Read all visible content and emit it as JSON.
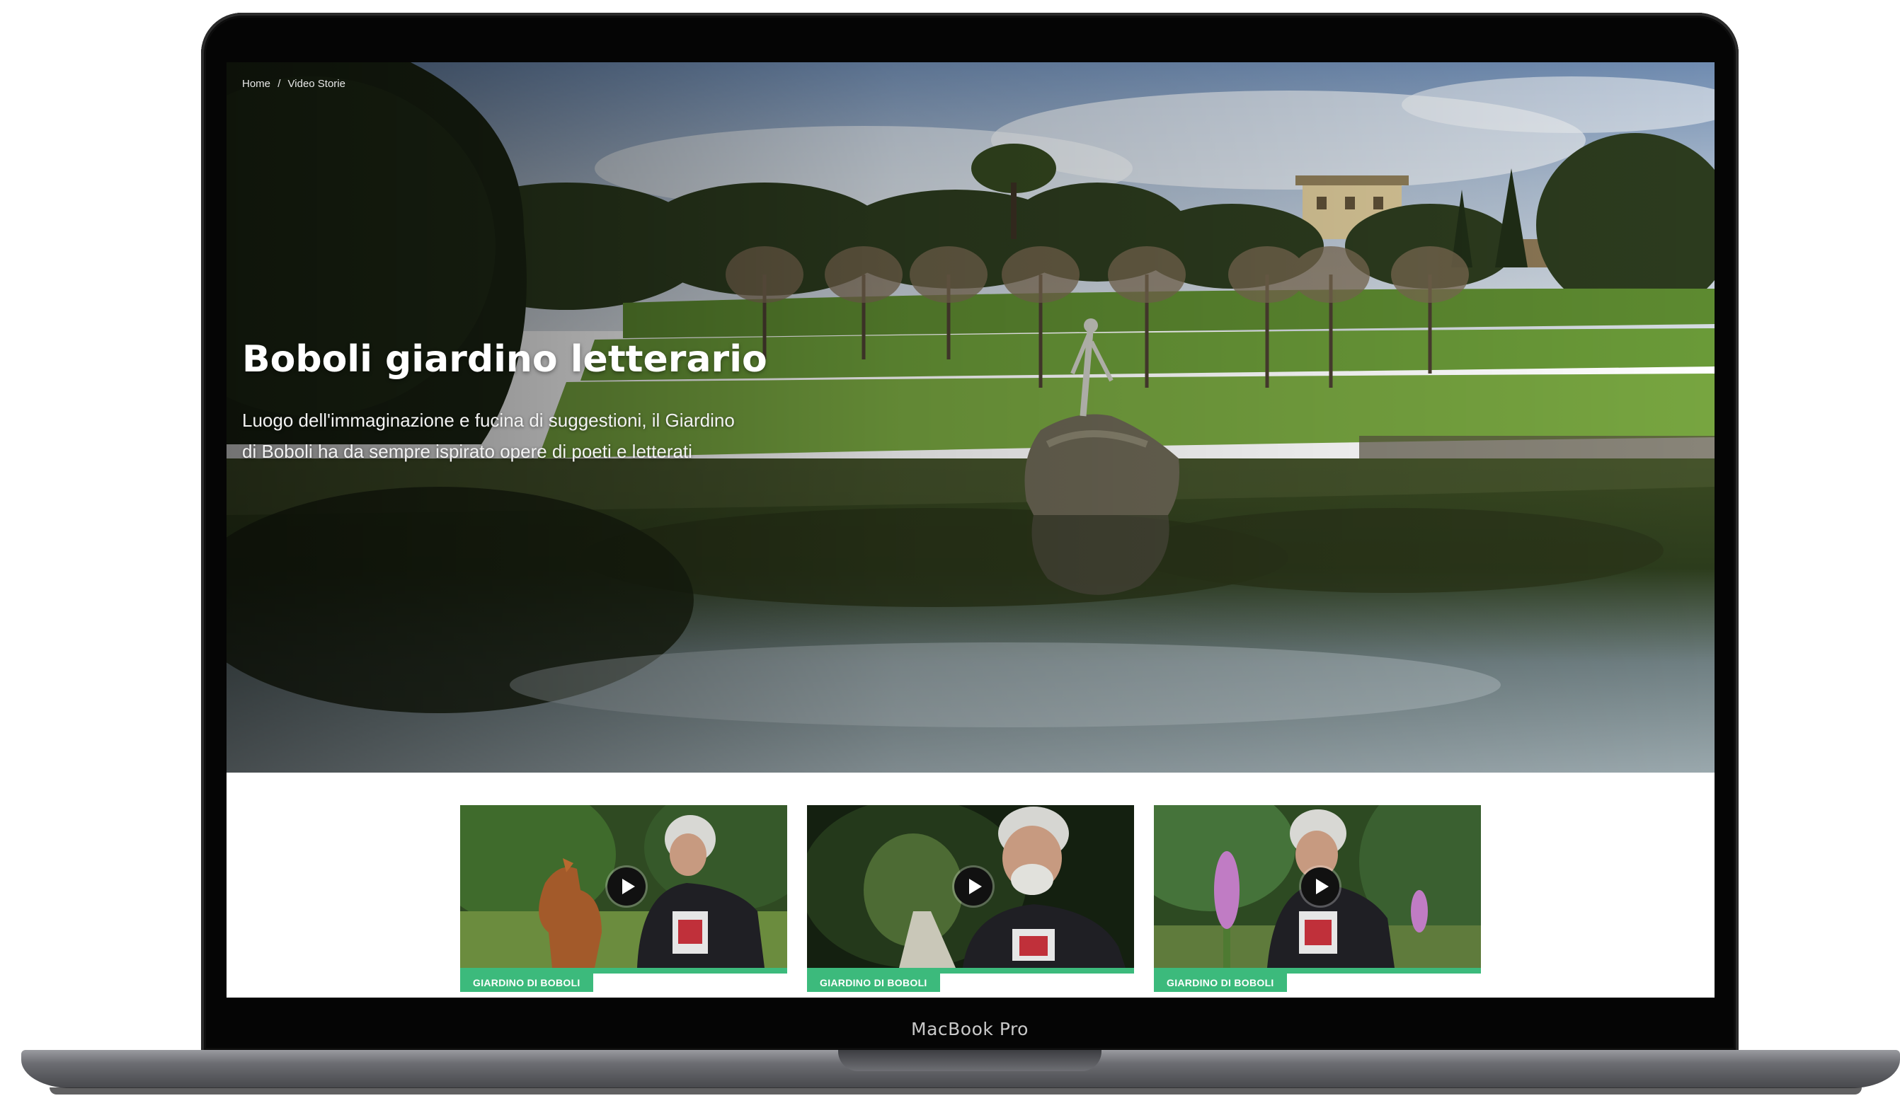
{
  "device": {
    "label": "MacBook Pro"
  },
  "breadcrumb": {
    "home": "Home",
    "separator": "/",
    "current": "Video Storie"
  },
  "hero": {
    "title": "Boboli giardino letterario",
    "description": "Luogo dell'immaginazione e fucina di suggestioni, il Giardino di Boboli ha da sempre ispirato opere di poeti e letterati"
  },
  "cards": [
    {
      "badge": "GIARDINO DI BOBOLI",
      "thumbnail": "man-with-dog-statue"
    },
    {
      "badge": "GIARDINO DI BOBOLI",
      "thumbnail": "man-in-tree-tunnel"
    },
    {
      "badge": "GIARDINO DI BOBOLI",
      "thumbnail": "man-with-purple-flowers"
    }
  ],
  "colors": {
    "accent": "#3cba7c",
    "play_button": "#111111"
  },
  "icons": {
    "play": "play-icon"
  }
}
